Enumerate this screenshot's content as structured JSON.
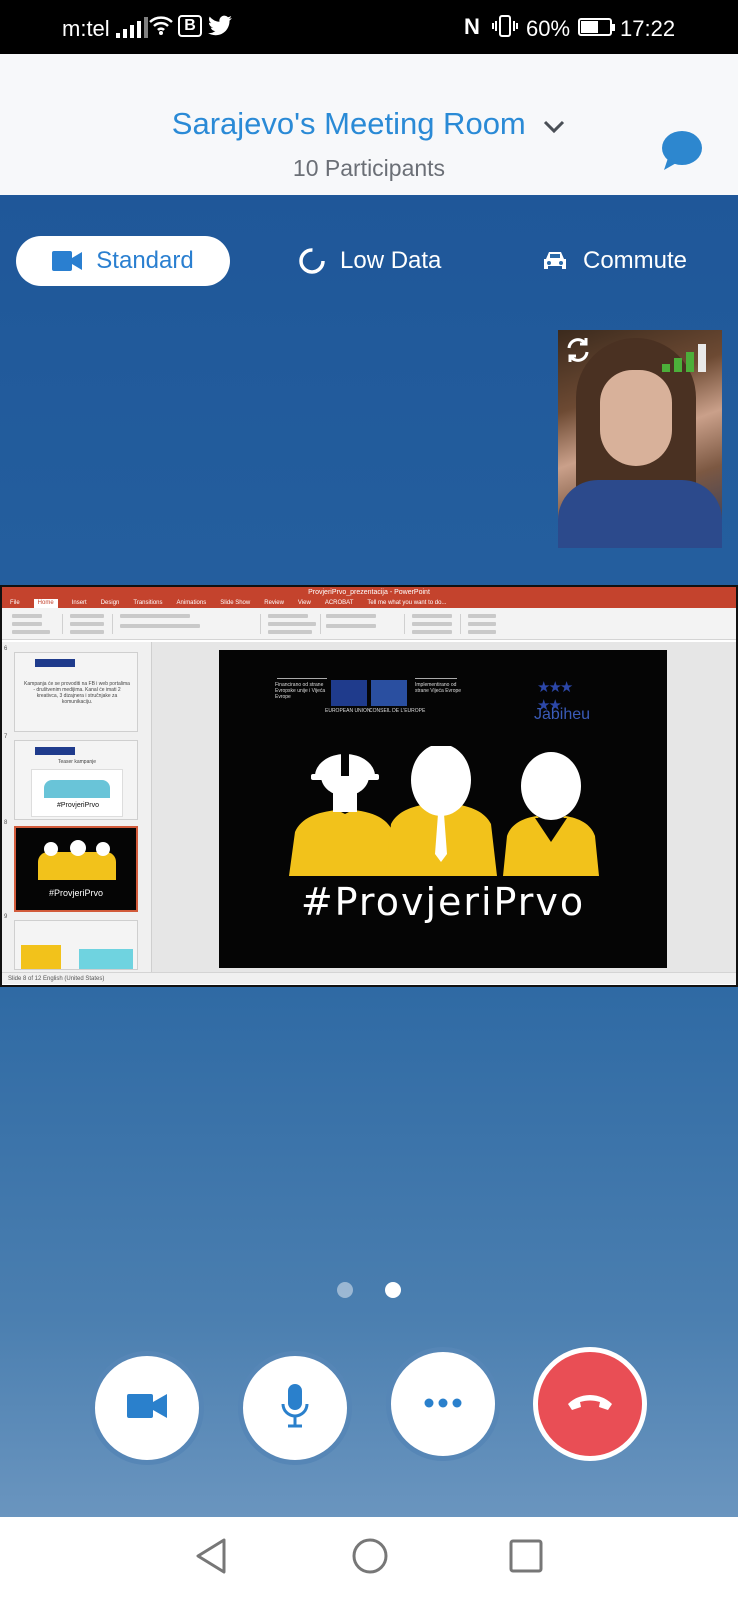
{
  "status_bar": {
    "carrier": "m:tel",
    "battery": "60%",
    "time": "17:22",
    "b_badge": "B",
    "nfc_badge": "N"
  },
  "header": {
    "title": "Sarajevo's Meeting Room",
    "subtitle": "10 Participants"
  },
  "modes": [
    {
      "label": "Standard",
      "icon": "video-camera-icon",
      "selected": true
    },
    {
      "label": "Low Data",
      "icon": "low-data-icon",
      "selected": false
    },
    {
      "label": "Commute",
      "icon": "car-icon",
      "selected": false
    }
  ],
  "shared_screen": {
    "window_title": "ProvjeriPrvo_prezentacija - PowerPoint",
    "tabs": [
      "File",
      "Home",
      "Insert",
      "Design",
      "Transitions",
      "Animations",
      "Slide Show",
      "Review",
      "View",
      "ACROBAT",
      "Tell me what you want to do..."
    ],
    "active_tab": "Home",
    "thumbnail_1_text": "Kampanja će se provoditi na FB i web portalima - društvenim medijima. Kanal će imati 2 kreativca, 3 dizajnera i stručnjake za komunikaciju.",
    "thumbnail_2_title": "Teaser kampanje",
    "slide_numbers": [
      "6",
      "7",
      "8",
      "9"
    ],
    "slide": {
      "hashtag": "#ProvjeriPrvo",
      "logo": "Jabiheu",
      "eu_text_1": "Financirano od strane Evropske unije i Vijeća Evrope",
      "eu_text_2": "Implementirano od strane Vijeća Evrope",
      "eu_label": "EUROPEAN UNION",
      "coe_label": "CONSEIL DE L'EUROPE"
    },
    "status_text": "Slide 8 of 12    English (United States)"
  },
  "pager": {
    "count": 2,
    "active": 2
  },
  "controls": [
    {
      "name": "video",
      "icon": "video-camera-icon"
    },
    {
      "name": "mic",
      "icon": "microphone-icon"
    },
    {
      "name": "more",
      "icon": "more-icon"
    },
    {
      "name": "end-call",
      "icon": "hang-up-icon"
    }
  ],
  "colors": {
    "accent": "#2a8ad6",
    "stage": "#1f5799",
    "end_call": "#e94e55",
    "signal_green": "#4caf3a"
  }
}
